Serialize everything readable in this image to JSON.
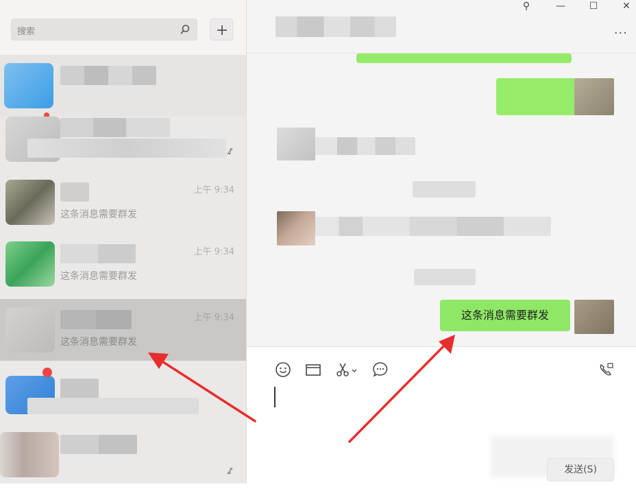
{
  "sidebar": {
    "search_placeholder": "搜索",
    "conversations": [
      {
        "time": "",
        "preview": ""
      },
      {
        "time": "",
        "preview": ""
      },
      {
        "time": "上午 9:34",
        "preview": "这条消息需要群发"
      },
      {
        "time": "上午 9:34",
        "preview": "这条消息需要群发"
      },
      {
        "time": "上午 9:34",
        "preview": "这条消息需要群发"
      },
      {
        "time": "",
        "preview": ""
      },
      {
        "time": "",
        "preview": ""
      }
    ]
  },
  "chat": {
    "window_buttons": {
      "pin": "✕",
      "minimize": "—",
      "maximize": "☐",
      "close": "✕"
    },
    "more_label": "···",
    "message_text": "这条消息需要群发",
    "send_label": "发送(S)"
  },
  "colors": {
    "bubble_green": "#95ec69",
    "accent_red": "#e62e2e",
    "sidebar_bg": "#ebe9e8",
    "chat_bg": "#f5f4f4"
  },
  "icons": [
    "search-icon",
    "plus-icon",
    "pin-icon",
    "minimize-icon",
    "maximize-icon",
    "close-icon",
    "more-icon",
    "emoji-icon",
    "folder-icon",
    "scissors-icon",
    "chat-bubble-icon",
    "video-call-icon",
    "mute-icon"
  ]
}
